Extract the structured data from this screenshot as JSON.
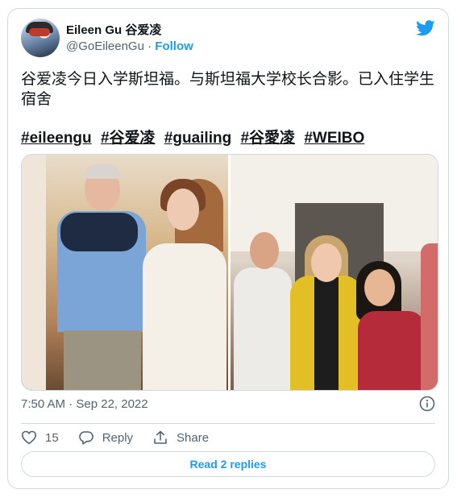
{
  "tweet": {
    "author_name": "Eileen Gu 谷爱凌",
    "handle": "@GoEileenGu",
    "separator": " · ",
    "follow_label": "Follow",
    "text": "谷爱凌今日入学斯坦福。与斯坦福大学校长合影。已入住学生宿舍",
    "hashtags": [
      "#eileengu",
      "#谷爱凌",
      "#guailing",
      "#谷愛凌",
      "#WEIBO"
    ],
    "timestamp": "7:50 AM · Sep 22, 2022",
    "like_count": "15",
    "reply_label": "Reply",
    "share_label": "Share",
    "read_replies_label": "Read 2 replies"
  },
  "icons": {
    "brand": "twitter-bird-icon",
    "info": "info-icon",
    "like": "heart-icon",
    "reply": "reply-bubble-icon",
    "share": "share-icon"
  },
  "colors": {
    "accent": "#1d9bf0",
    "text": "#0f1419",
    "muted": "#536471",
    "border": "#cfd9de"
  }
}
